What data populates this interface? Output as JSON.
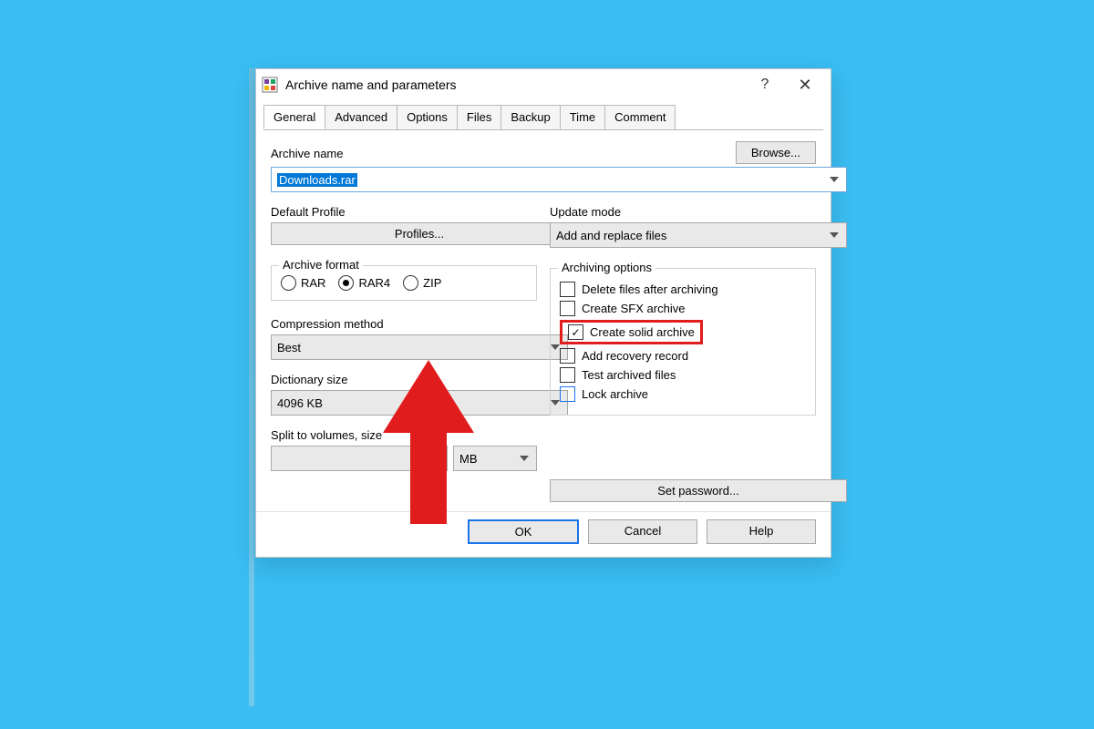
{
  "title": "Archive name and parameters",
  "titlebar": {
    "help": "?",
    "close": "✕"
  },
  "tabs": [
    "General",
    "Advanced",
    "Options",
    "Files",
    "Backup",
    "Time",
    "Comment"
  ],
  "archive_name": {
    "label": "Archive name",
    "browse": "Browse...",
    "value": "Downloads.rar"
  },
  "default_profile": {
    "label": "Default Profile",
    "button": "Profiles..."
  },
  "archive_format": {
    "legend": "Archive format",
    "options": [
      "RAR",
      "RAR4",
      "ZIP"
    ],
    "selected": "RAR4"
  },
  "compression": {
    "label": "Compression method",
    "value": "Best"
  },
  "dictionary": {
    "label": "Dictionary size",
    "value": "4096 KB"
  },
  "split": {
    "label": "Split to volumes, size",
    "value": "",
    "unit": "MB"
  },
  "update_mode": {
    "label": "Update mode",
    "value": "Add and replace files"
  },
  "archiving_options": {
    "legend": "Archiving options",
    "items": [
      {
        "label": "Delete files after archiving",
        "checked": false
      },
      {
        "label": "Create SFX archive",
        "checked": false
      },
      {
        "label": "Create solid archive",
        "checked": true,
        "highlighted": true
      },
      {
        "label": "Add recovery record",
        "checked": false
      },
      {
        "label": "Test archived files",
        "checked": false
      },
      {
        "label": "Lock archive",
        "checked": false
      }
    ]
  },
  "set_password": "Set password...",
  "buttons": {
    "ok": "OK",
    "cancel": "Cancel",
    "help": "Help"
  }
}
